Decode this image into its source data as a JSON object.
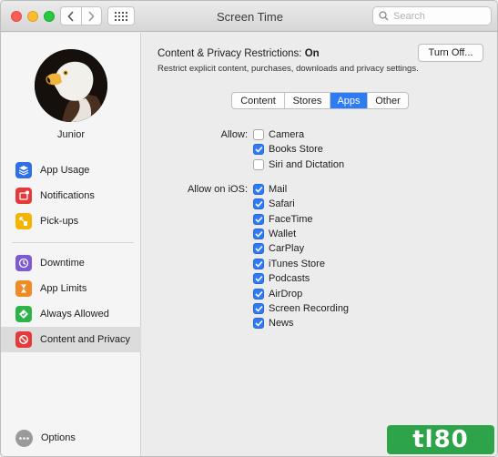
{
  "window": {
    "title": "Screen Time"
  },
  "search": {
    "placeholder": "Search"
  },
  "user": {
    "name": "Junior"
  },
  "sidebar": {
    "items": [
      {
        "label": "App Usage",
        "icon": "app-usage-icon",
        "color": "#2f6fe4"
      },
      {
        "label": "Notifications",
        "icon": "notifications-icon",
        "color": "#e5393a"
      },
      {
        "label": "Pick-ups",
        "icon": "pickups-icon",
        "color": "#f5b400"
      },
      {
        "label": "Downtime",
        "icon": "downtime-icon",
        "color": "#7d5ad1"
      },
      {
        "label": "App Limits",
        "icon": "hourglass-icon",
        "color": "#f08a24"
      },
      {
        "label": "Always Allowed",
        "icon": "always-allowed-icon",
        "color": "#2db34a"
      },
      {
        "label": "Content and Privacy",
        "icon": "restricted-icon",
        "color": "#e5393a"
      }
    ],
    "active_index": 6,
    "options_label": "Options"
  },
  "restrictions": {
    "title_prefix": "Content & Privacy Restrictions:",
    "status": "On",
    "description": "Restrict explicit content, purchases, downloads and privacy settings.",
    "turn_off_label": "Turn Off..."
  },
  "tabs": {
    "items": [
      "Content",
      "Stores",
      "Apps",
      "Other"
    ],
    "selected": "Apps"
  },
  "allow": {
    "label": "Allow:",
    "items": [
      {
        "label": "Camera",
        "checked": false
      },
      {
        "label": "Books Store",
        "checked": true
      },
      {
        "label": "Siri and Dictation",
        "checked": false
      }
    ]
  },
  "allow_ios": {
    "label": "Allow on iOS:",
    "items": [
      {
        "label": "Mail",
        "checked": true
      },
      {
        "label": "Safari",
        "checked": true
      },
      {
        "label": "FaceTime",
        "checked": true
      },
      {
        "label": "Wallet",
        "checked": true
      },
      {
        "label": "CarPlay",
        "checked": true
      },
      {
        "label": "iTunes Store",
        "checked": true
      },
      {
        "label": "Podcasts",
        "checked": true
      },
      {
        "label": "AirDrop",
        "checked": true
      },
      {
        "label": "Screen Recording",
        "checked": true
      },
      {
        "label": "News",
        "checked": true
      }
    ]
  },
  "watermark": {
    "text": "tl80"
  },
  "colors": {
    "accent": "#2f7bf5"
  }
}
